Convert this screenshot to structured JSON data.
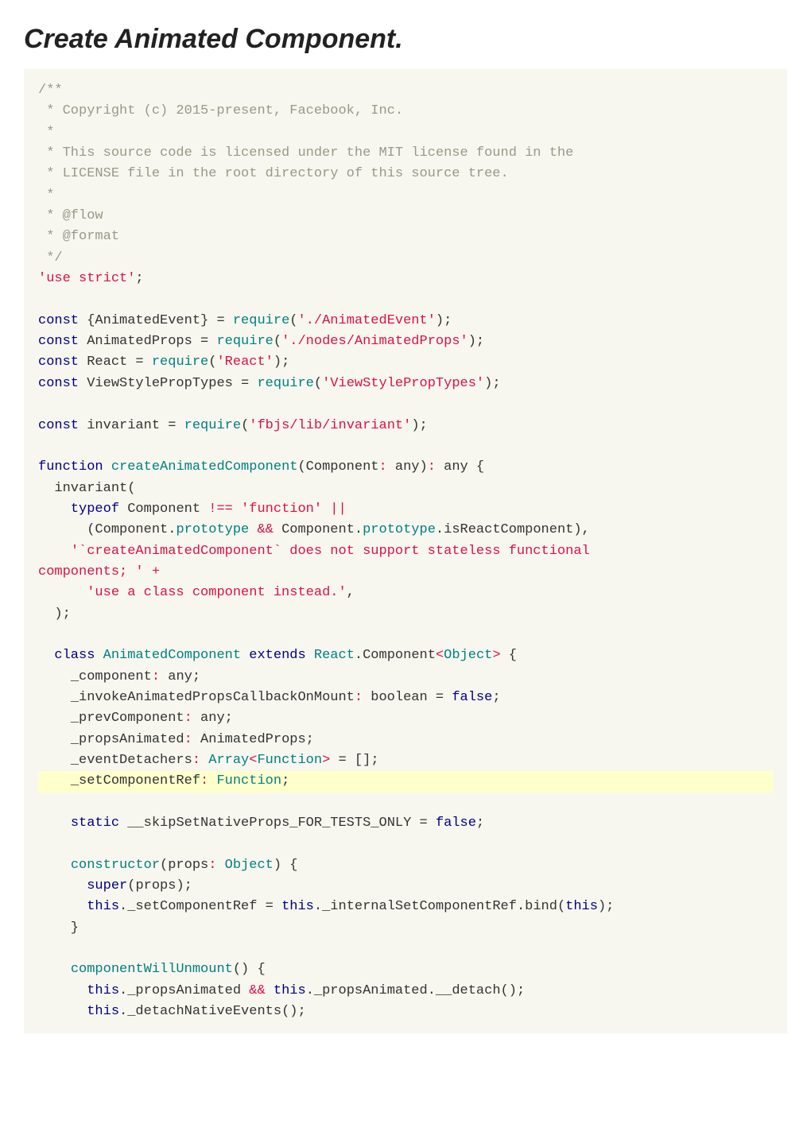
{
  "title": "Create Animated Component.",
  "code": {
    "comment_block": [
      "/**",
      " * Copyright (c) 2015-present, Facebook, Inc.",
      " *",
      " * This source code is licensed under the MIT license found in the",
      " * LICENSE file in the root directory of this source tree.",
      " *",
      " * @flow",
      " * @format",
      " */"
    ],
    "use_strict": "'use strict'",
    "require_lines": {
      "const_kw": "const",
      "AnimatedEvent": "{AnimatedEvent}",
      "require_kw": "require",
      "path_animated_event": "'./AnimatedEvent'",
      "AnimatedProps": "AnimatedProps",
      "path_animated_props": "'./nodes/AnimatedProps'",
      "React": "React",
      "path_react": "'React'",
      "ViewStylePropTypes": "ViewStylePropTypes",
      "path_viewstyle": "'ViewStylePropTypes'",
      "invariant": "invariant",
      "path_invariant": "'fbjs/lib/invariant'"
    },
    "fn": {
      "function_kw": "function",
      "name": "createAnimatedComponent",
      "param": "Component",
      "any": "any",
      "invariant_call": "invariant",
      "typeof_kw": "typeof",
      "ne": "!==",
      "fn_str": "'function'",
      "or": "||",
      "prototype": "prototype",
      "and": "&&",
      "isReactComponent": ".isReactComponent),",
      "err1_a": "'`createAnimatedComponent` does not support stateless functional",
      "err1_b": "components; '",
      "plus": "+",
      "err2": "'use a class component instead.'"
    },
    "cls": {
      "class_kw": "class",
      "name": "AnimatedComponent",
      "extends_kw": "extends",
      "React": "React",
      "Component": ".Component",
      "Object": "Object",
      "fields": {
        "component": "_component",
        "any": "any",
        "invoke": "_invokeAnimatedPropsCallbackOnMount",
        "boolean": "boolean",
        "false": "false",
        "prev": "_prevComponent",
        "propsAnimated": "_propsAnimated",
        "AnimatedProps": "AnimatedProps",
        "eventDetachers": "_eventDetachers",
        "Array": "Array",
        "Function": "Function",
        "empty_array": "[]",
        "setComponentRef": "_setComponentRef"
      },
      "static_kw": "static",
      "skip": "__skipSetNativeProps_FOR_TESTS_ONLY",
      "eq": "=",
      "ctor": {
        "constructor_kw": "constructor",
        "props": "props",
        "Object": "Object",
        "super_kw": "super",
        "this_kw": "this",
        "set_ref": "._setComponentRef",
        "internal": "._internalSetComponentRef",
        "bind": ".bind"
      },
      "unmount": {
        "name": "componentWillUnmount",
        "this_kw": "this",
        "propsAnimated": "._propsAnimated",
        "and": "&&",
        "detach": ".__detach",
        "detachNative": "._detachNativeEvents"
      }
    }
  }
}
